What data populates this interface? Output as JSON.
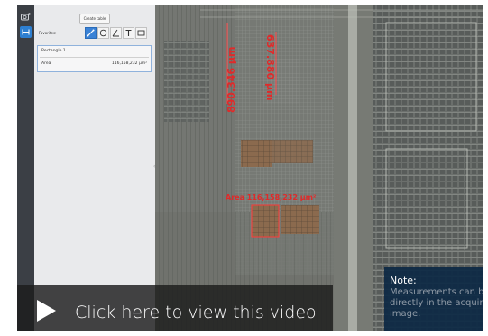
{
  "toolbar": {
    "create_table_label": "Create table",
    "favorites_label": "Favorites:",
    "tools": [
      "line-tool-icon",
      "circle-tool-icon",
      "angle-tool-icon",
      "text-tool-icon",
      "rectangle-tool-icon"
    ]
  },
  "measurement": {
    "name": "Rectangle 1",
    "area_label": "Area",
    "area_value": "116,158,232 µm²"
  },
  "image": {
    "labels": {
      "vertical_right": "637.880 µm",
      "vertical_left": "890.346 µm",
      "area": "Area 116,158,232 µm²"
    }
  },
  "video": {
    "label": "Click here to view this video"
  },
  "note": {
    "title": "Note:",
    "body": "Measurements can be done directly in the acquired image."
  },
  "colors": {
    "accent": "#2d7fd1",
    "measurement": "#e02a2a",
    "note_bg": "#0c2844"
  }
}
